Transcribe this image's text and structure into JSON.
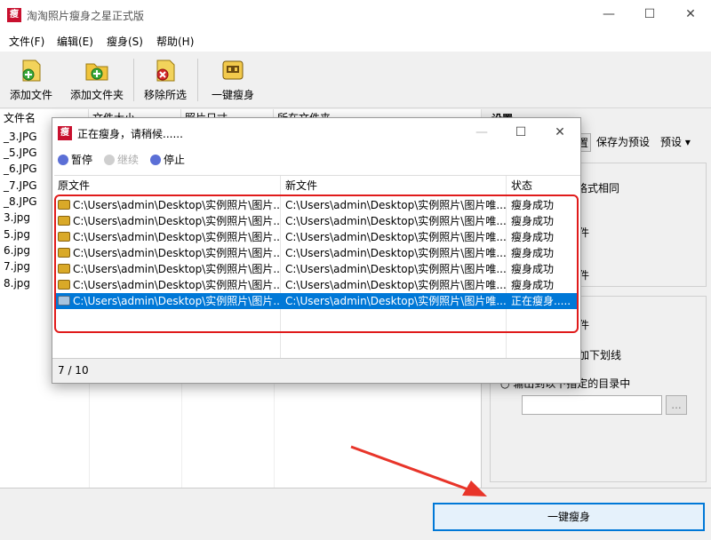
{
  "window": {
    "title": "淘淘照片瘦身之星正式版",
    "app_icon_char": "瘦",
    "minimize": "—",
    "maximize": "☐",
    "close": "✕"
  },
  "menu": [
    "文件(F)",
    "编辑(E)",
    "瘦身(S)",
    "帮助(H)"
  ],
  "toolbar": {
    "add_files": "添加文件",
    "add_folder": "添加文件夹",
    "remove_selected": "移除所选",
    "one_click_slim": "一键瘦身"
  },
  "main_list": {
    "columns": [
      "文件名",
      "文件大小",
      "照片日寸",
      "所在文件夹"
    ],
    "files": [
      "_3.JPG",
      "_5.JPG",
      "_6.JPG",
      "_7.JPG",
      "_8.JPG",
      "3.jpg",
      "5.jpg",
      "6.jpg",
      "7.jpg",
      "8.jpg"
    ]
  },
  "settings": {
    "title": "设置",
    "buttons": [
      "置",
      "保存为预设",
      "预设"
    ],
    "text1": "格式相同",
    "text2": "件",
    "text3": "件",
    "text4": "件",
    "text5": "加下划线",
    "output_option": "输出到以下指定的目录中",
    "browse": "..."
  },
  "bottom": {
    "slim_button": "一键瘦身"
  },
  "dialog": {
    "title": "正在瘦身，请稍候......",
    "pause": "暂停",
    "resume": "继续",
    "stop": "停止",
    "columns": {
      "source": "原文件",
      "target": "新文件",
      "status": "状态"
    },
    "rows": [
      {
        "source": "C:\\Users\\admin\\Desktop\\实例照片\\图片...",
        "target": "C:\\Users\\admin\\Desktop\\实例照片\\图片唯...",
        "status": "瘦身成功"
      },
      {
        "source": "C:\\Users\\admin\\Desktop\\实例照片\\图片...",
        "target": "C:\\Users\\admin\\Desktop\\实例照片\\图片唯...",
        "status": "瘦身成功"
      },
      {
        "source": "C:\\Users\\admin\\Desktop\\实例照片\\图片...",
        "target": "C:\\Users\\admin\\Desktop\\实例照片\\图片唯...",
        "status": "瘦身成功"
      },
      {
        "source": "C:\\Users\\admin\\Desktop\\实例照片\\图片...",
        "target": "C:\\Users\\admin\\Desktop\\实例照片\\图片唯...",
        "status": "瘦身成功"
      },
      {
        "source": "C:\\Users\\admin\\Desktop\\实例照片\\图片...",
        "target": "C:\\Users\\admin\\Desktop\\实例照片\\图片唯...",
        "status": "瘦身成功"
      },
      {
        "source": "C:\\Users\\admin\\Desktop\\实例照片\\图片...",
        "target": "C:\\Users\\admin\\Desktop\\实例照片\\图片唯...",
        "status": "瘦身成功"
      },
      {
        "source": "C:\\Users\\admin\\Desktop\\实例照片\\图片...",
        "target": "C:\\Users\\admin\\Desktop\\实例照片\\图片唯...",
        "status": "正在瘦身....."
      }
    ],
    "progress": "7 / 10"
  },
  "colors": {
    "accent": "#0078d7",
    "highlight": "#e01b1b",
    "arrow": "#e8352a"
  }
}
